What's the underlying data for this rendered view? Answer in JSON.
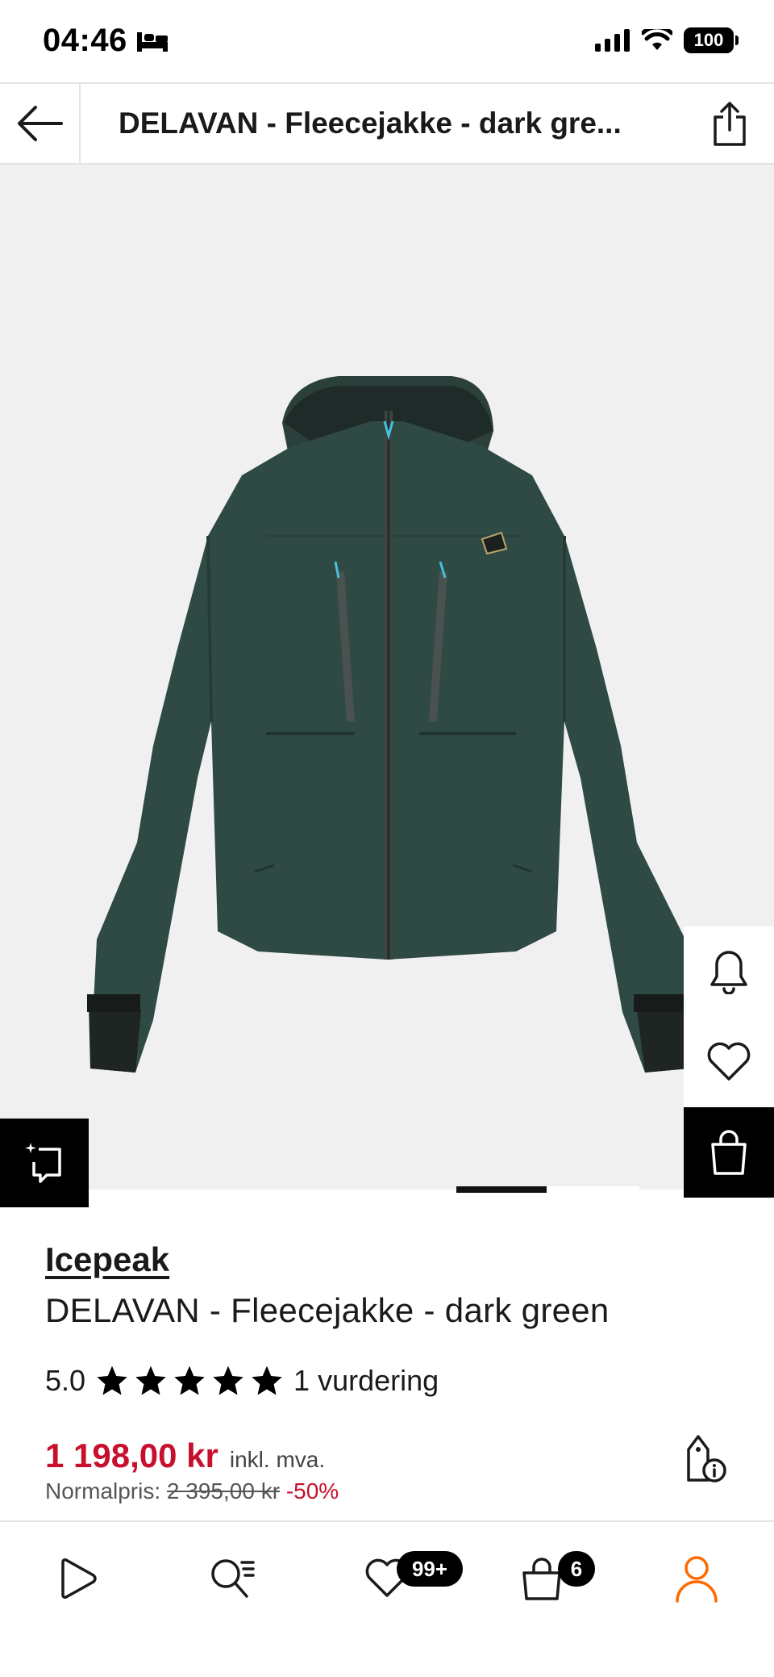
{
  "status_bar": {
    "time": "04:46",
    "battery": "100"
  },
  "nav": {
    "title": "DELAVAN - Fleecejakke - dark gre..."
  },
  "product": {
    "brand": "Icepeak",
    "name": "DELAVAN - Fleecejakke - dark green",
    "rating_value": "5.0",
    "stars": 5,
    "rating_count": "1 vurdering",
    "price": "1 198,00 kr",
    "vat_note": "inkl. mva.",
    "normal_label": "Normalpris:",
    "normal_price": "2 395,00 kr",
    "discount": "-50%",
    "colors": {
      "sale": "#c8102e",
      "jacket": "#2f4a44"
    }
  },
  "icons": {
    "back": "arrow-left-icon",
    "share": "share-icon",
    "bell": "bell-icon",
    "wishlist": "heart-icon",
    "bag": "shopping-bag-icon",
    "compare": "compare-icon",
    "price_info": "price-tag-info-icon"
  },
  "tabbar": {
    "items": [
      {
        "name": "play-tab",
        "icon": "play-icon"
      },
      {
        "name": "search-tab",
        "icon": "search-list-icon"
      },
      {
        "name": "wishlist-tab",
        "icon": "heart-icon",
        "badge": "99+"
      },
      {
        "name": "bag-tab",
        "icon": "bag-icon",
        "badge": "6"
      },
      {
        "name": "profile-tab",
        "icon": "person-icon",
        "active": true
      }
    ],
    "accent": "#ff6900"
  }
}
